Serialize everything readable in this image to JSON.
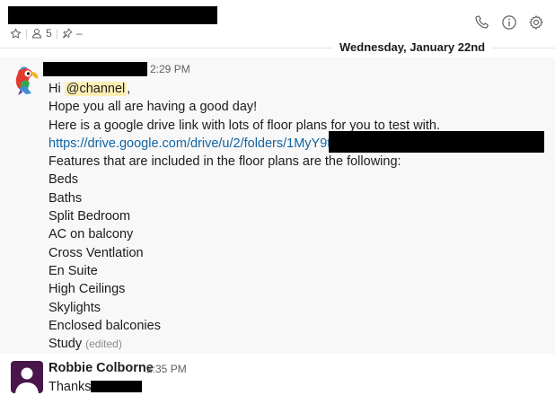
{
  "header": {
    "member_count": "5",
    "pins": "–",
    "icons": [
      "star-icon",
      "member-icon",
      "pin-icon",
      "phone-icon",
      "info-icon",
      "gear-icon"
    ]
  },
  "divider": {
    "date": "Wednesday, January 22nd"
  },
  "message1": {
    "time": "2:29 PM",
    "greeting": "Hi",
    "mention": "@channel",
    "greeting_end": ",",
    "lines": [
      "Hope you all are having a good day!",
      "Here is a google drive link with lots of floor plans for you to test with."
    ],
    "link": "https://drive.google.com/drive/u/2/folders/1MyY9t",
    "features_intro": "Features that are included in the floor plans are the following:",
    "features": [
      "Beds",
      "Baths",
      "Split Bedroom",
      "AC on balcony",
      "Cross Ventlation",
      "En Suite",
      "High Ceilings",
      "Skylights",
      "Enclosed balconies",
      "Study"
    ],
    "edited": "(edited)"
  },
  "message2": {
    "author": "Robbie Colborne",
    "time": "2:35 PM",
    "text": "Thanks"
  },
  "colors": {
    "link": "#1264a3",
    "mention_bg": "#fcefb4",
    "avatar2": "#4a154b"
  }
}
